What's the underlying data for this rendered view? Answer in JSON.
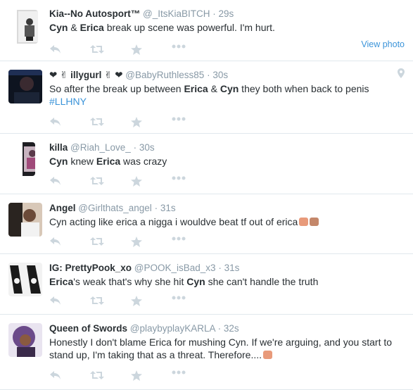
{
  "colors": {
    "name": "#292f33",
    "meta": "#8899a6",
    "link": "#3b94d9",
    "action_icon": "#ccd6dd",
    "divider": "#e1e8ed"
  },
  "tweets": [
    {
      "name": "Kia--No Autosport™",
      "handle": "@_ItsKiaBITCH",
      "time": "29s",
      "text": [
        "Cyn",
        " & ",
        "Erica",
        " break up scene was powerful. I'm hurt."
      ],
      "view_photo": "View photo"
    },
    {
      "name": "❤ ✌ illygurl ✌ ❤",
      "handle": "@BabyRuthless85",
      "time": "30s",
      "text": [
        "So after the break up between ",
        "Erica",
        " & ",
        "Cyn",
        " they both when back to penis "
      ],
      "hashtag": "#LLHNY",
      "geo_icon": "map-pin-icon"
    },
    {
      "name": "killa",
      "handle": "@Riah_Love_",
      "time": "30s",
      "text": [
        "Cyn",
        " knew ",
        "Erica",
        " was crazy"
      ]
    },
    {
      "name": "Angel",
      "handle": "@Girlthats_angel",
      "time": "31s",
      "text": [
        "Cyn acting like erica a nigga i wouldve beat tf out of erica"
      ]
    },
    {
      "name": "IG: PrettyPook_xo",
      "handle": "@POOK_isBad_x3",
      "time": "31s",
      "text": [
        "Erica",
        "'s weak that's why she hit ",
        "Cyn",
        " she can't handle the truth"
      ]
    },
    {
      "name": "Queen of Swords",
      "handle": "@playbyplayKARLA",
      "time": "32s",
      "text": [
        "Honestly I don't blame Erica for mushing Cyn. If we're arguing, and you start to stand up, I'm taking that as a threat. Therefore...."
      ]
    }
  ],
  "separator": "·",
  "action_icons": [
    "reply-icon",
    "retweet-icon",
    "favorite-icon",
    "more-icon"
  ]
}
